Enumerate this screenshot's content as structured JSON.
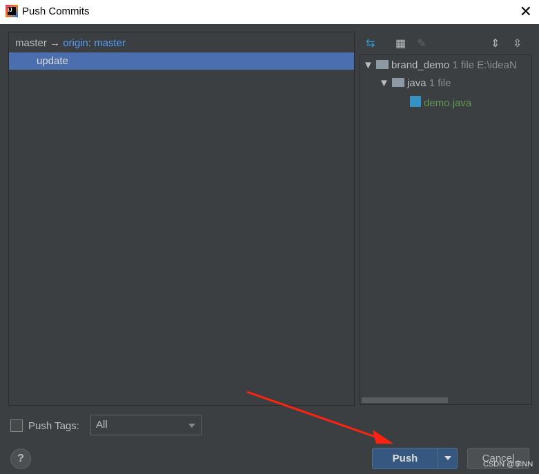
{
  "window": {
    "title": "Push Commits",
    "close": "✕"
  },
  "commits": {
    "branch_source": "master",
    "arrow": "→",
    "remote": "origin",
    "separator": ":",
    "branch_target": "master",
    "items": [
      {
        "message": "update"
      }
    ]
  },
  "changes": {
    "root": {
      "name": "brand_demo",
      "count": "1 file",
      "path": "E:\\ideaN"
    },
    "folder": {
      "name": "java",
      "count": "1 file"
    },
    "file": {
      "name": "demo.java"
    }
  },
  "options": {
    "push_tags_label": "Push Tags:",
    "push_tags_checked": false,
    "tags_select": "All"
  },
  "buttons": {
    "help": "?",
    "push": "Push",
    "cancel": "Cancel"
  },
  "watermark": "CSDN @李NN",
  "colors": {
    "selection": "#4b6eaf",
    "link": "#589df6",
    "file_added": "#629755",
    "push": "#365880"
  }
}
